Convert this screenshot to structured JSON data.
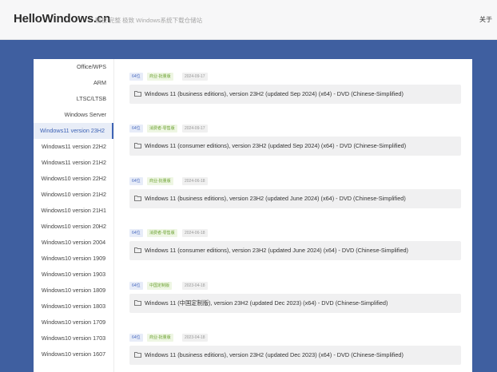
{
  "header": {
    "brand": "HelloWindows.cn",
    "tagline": "精校 完整 极致 Windows系统下载仓储站",
    "about": "关于"
  },
  "sidebar": {
    "items": [
      {
        "label": "Office/WPS"
      },
      {
        "label": "ARM"
      },
      {
        "label": "LTSC/LTSB"
      },
      {
        "label": "Windows Server"
      },
      {
        "label": "Windows11 version 23H2",
        "active": true
      },
      {
        "label": "Windows11 version 22H2"
      },
      {
        "label": "Windows11 version 21H2"
      },
      {
        "label": "Windows10 version 22H2"
      },
      {
        "label": "Windows10 version 21H2"
      },
      {
        "label": "Windows10 version 21H1"
      },
      {
        "label": "Windows10 version 20H2"
      },
      {
        "label": "Windows10 version 2004"
      },
      {
        "label": "Windows10 version 1909"
      },
      {
        "label": "Windows10 version 1903"
      },
      {
        "label": "Windows10 version 1809"
      },
      {
        "label": "Windows10 version 1803"
      },
      {
        "label": "Windows10 version 1709"
      },
      {
        "label": "Windows10 version 1703"
      },
      {
        "label": "Windows10 version 1607"
      }
    ]
  },
  "entries": [
    {
      "bits": "64位",
      "edition": "商业-批量版",
      "date": "2024-09-17",
      "name": "Windows 11 (business editions), version 23H2 (updated Sep 2024) (x64) - DVD (Chinese-Simplified)"
    },
    {
      "bits": "64位",
      "edition": "消费者-零售版",
      "date": "2024-09-17",
      "name": "Windows 11 (consumer editions), version 23H2 (updated Sep 2024) (x64) - DVD (Chinese-Simplified)"
    },
    {
      "bits": "64位",
      "edition": "商业-批量版",
      "date": "2024-06-18",
      "name": "Windows 11 (business editions), version 23H2 (updated June 2024) (x64) - DVD (Chinese-Simplified)"
    },
    {
      "bits": "64位",
      "edition": "消费者-零售版",
      "date": "2024-06-18",
      "name": "Windows 11 (consumer editions), version 23H2 (updated June 2024) (x64) - DVD (Chinese-Simplified)"
    },
    {
      "bits": "64位",
      "edition": "中国定制版",
      "date": "2023-04-18",
      "name": "Windows 11 (中国定制版), version 23H2 (updated Dec 2023) (x64) - DVD (Chinese-Simplified)"
    },
    {
      "bits": "64位",
      "edition": "商业-批量版",
      "date": "2023-04-18",
      "name": "Windows 11 (business editions), version 23H2 (updated Dec 2023) (x64) - DVD (Chinese-Simplified)"
    }
  ],
  "colors": {
    "page_background": "#3f5fa0",
    "accent": "#3e63b5",
    "edition_tag": "#6da233"
  },
  "icons": {
    "entry_icon": "folder-icon"
  }
}
